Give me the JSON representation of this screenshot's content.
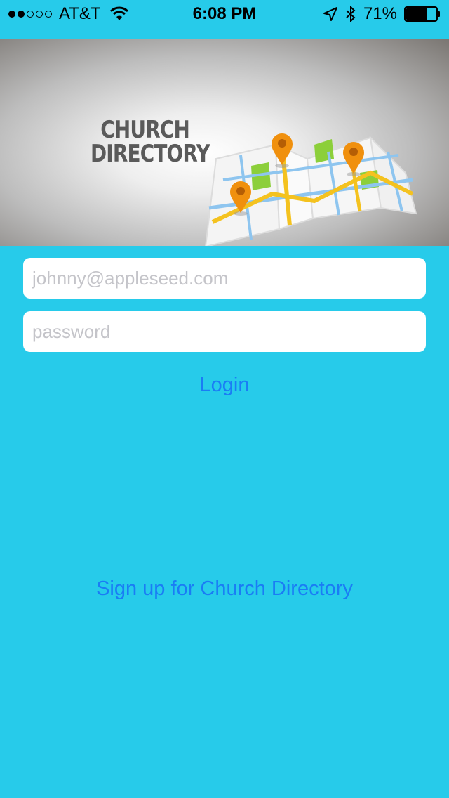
{
  "status_bar": {
    "carrier": "AT&T",
    "time": "6:08 PM",
    "battery_percent": "71%",
    "battery_level": 0.71,
    "signal_bars_filled": 2,
    "signal_bars_total": 5
  },
  "banner": {
    "title_line1": "CHURCH",
    "title_line2": "DIRECTORY"
  },
  "login_form": {
    "email_placeholder": "johnny@appleseed.com",
    "password_placeholder": "password",
    "login_label": "Login",
    "signup_label": "Sign up for Church Directory"
  },
  "colors": {
    "background": "#27cbea",
    "link": "#1a7cf5",
    "field": "#ffffff"
  },
  "icons": [
    "wifi-icon",
    "location-arrow-icon",
    "bluetooth-icon",
    "battery-icon",
    "map-pin-icon"
  ]
}
